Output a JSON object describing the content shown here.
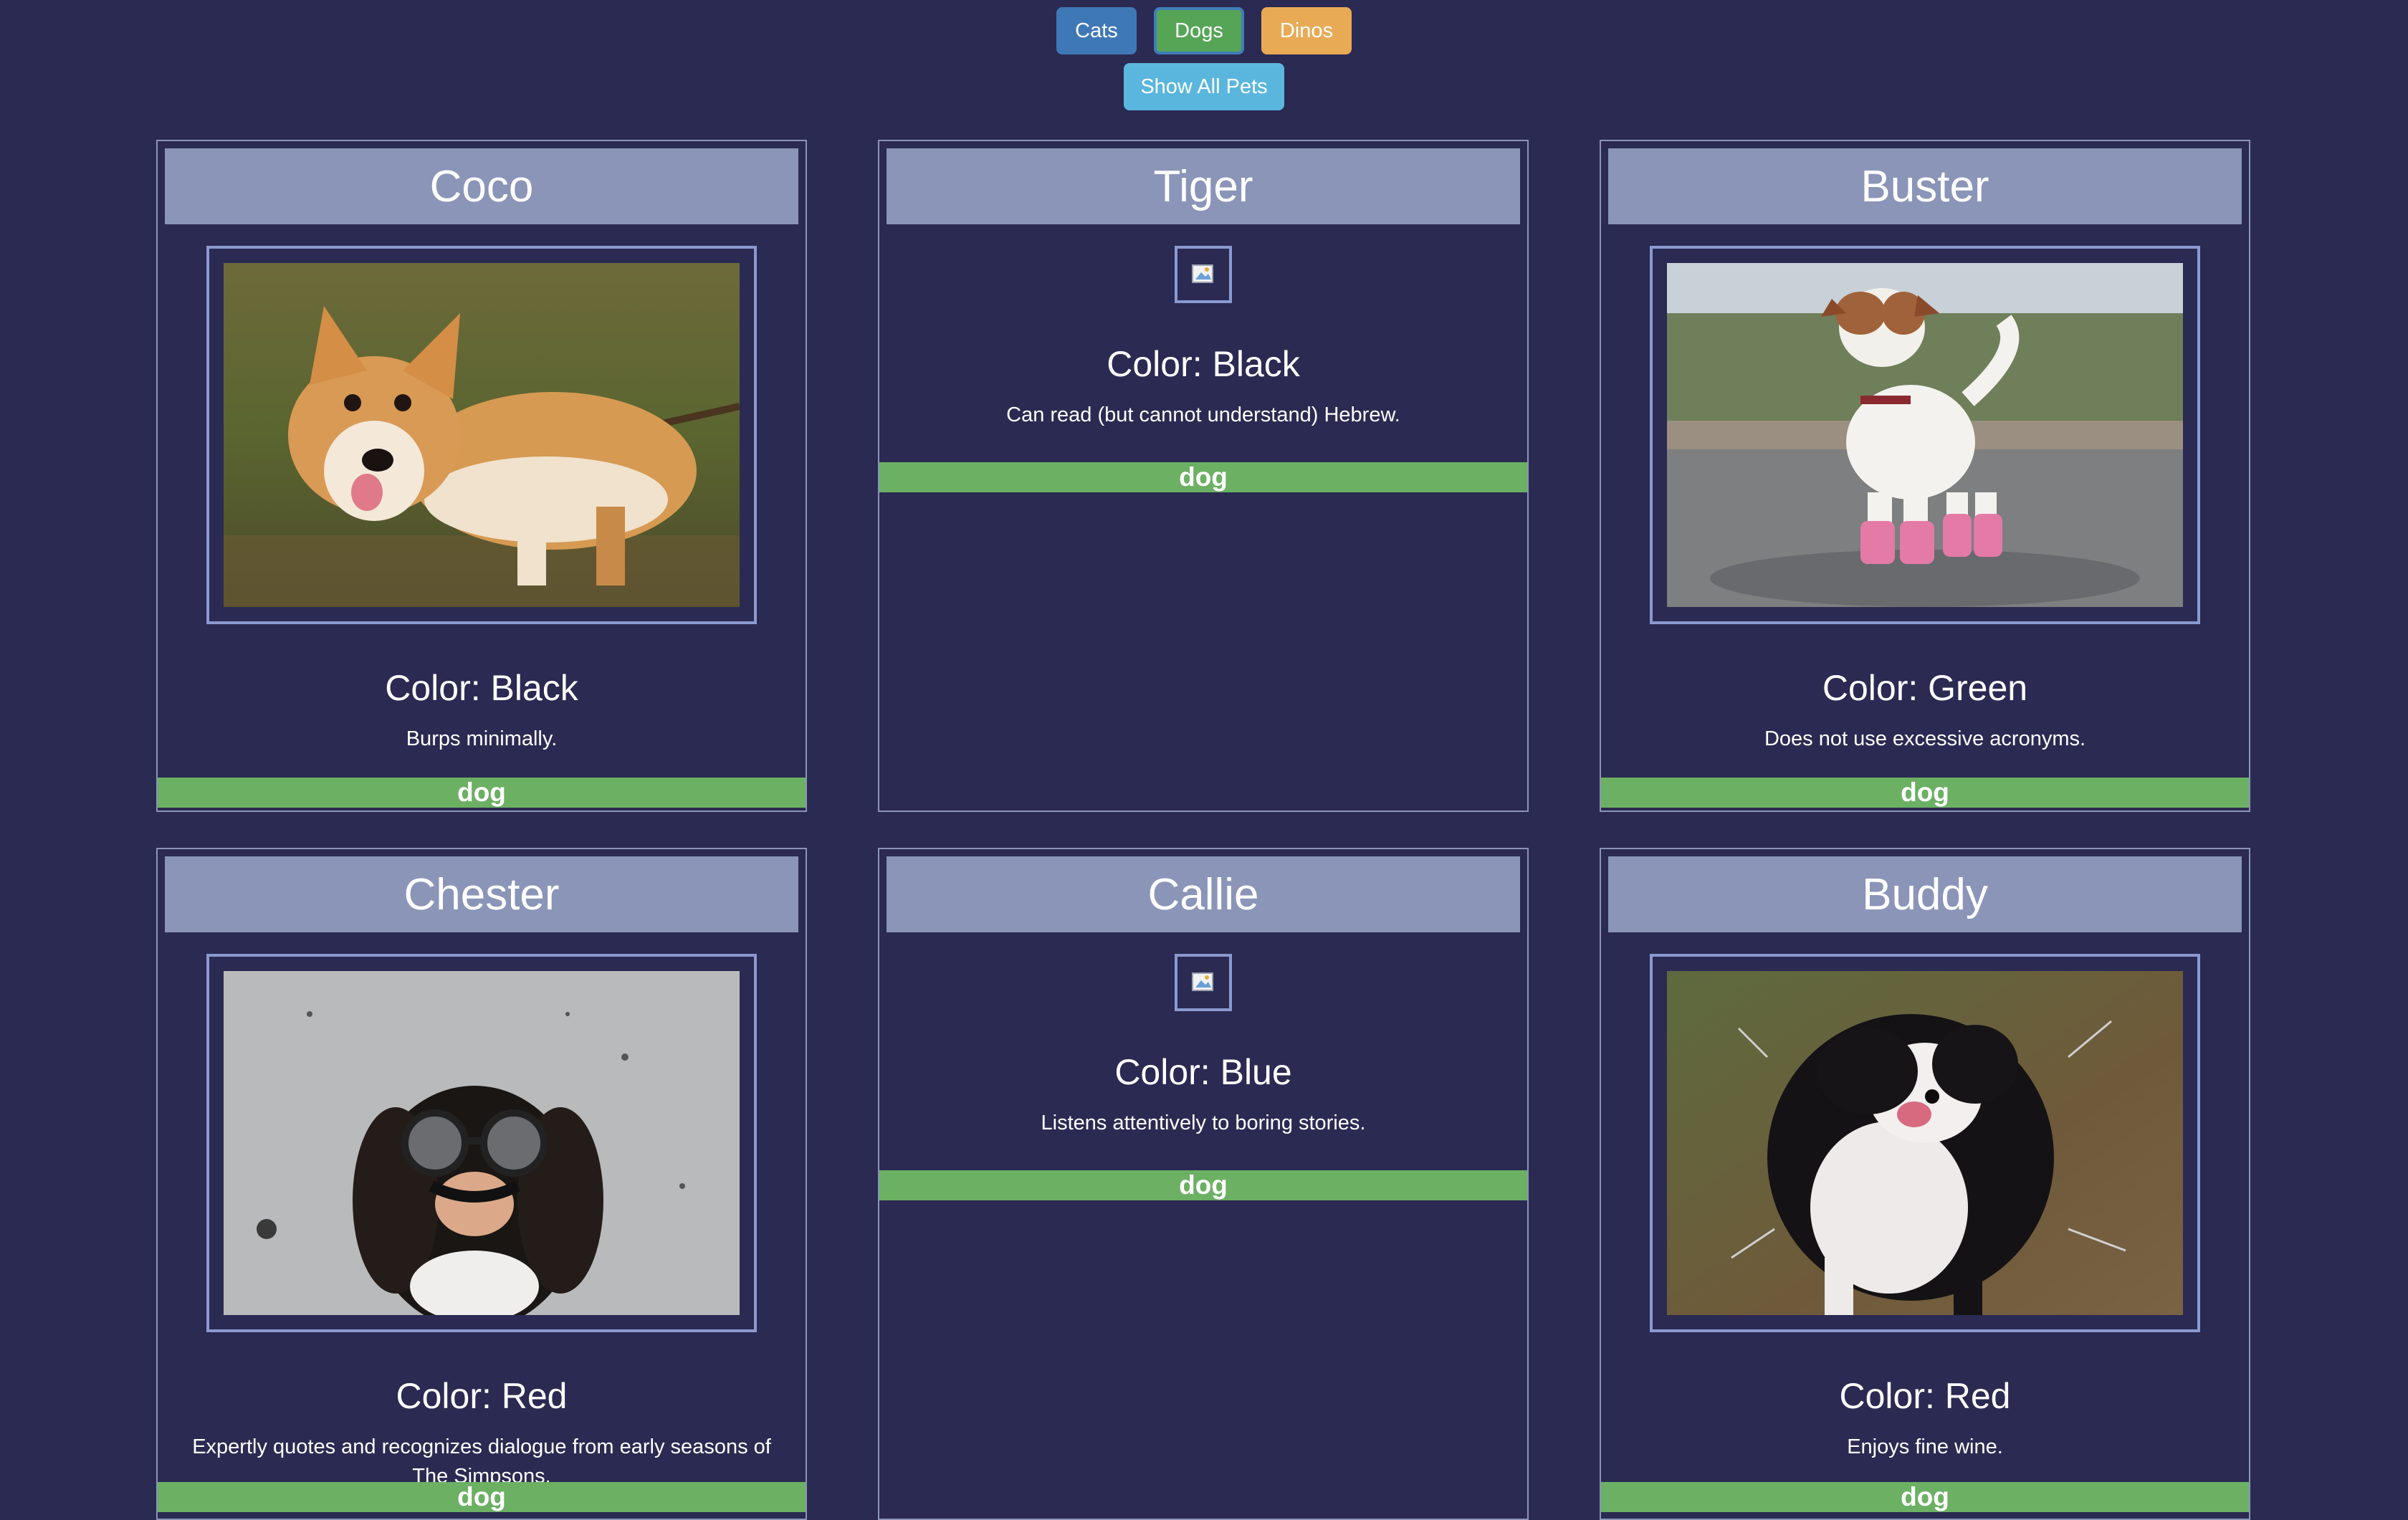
{
  "filters": {
    "cats": "Cats",
    "dogs": "Dogs",
    "dinos": "Dinos",
    "show_all": "Show All Pets"
  },
  "pets": [
    {
      "name": "Coco",
      "color": "Color: Black",
      "desc": "Burps minimally.",
      "type": "dog",
      "has_image": true,
      "image": "corgi-with-stick"
    },
    {
      "name": "Tiger",
      "color": "Color: Black",
      "desc": "Can read (but cannot understand) Hebrew.",
      "type": "dog",
      "has_image": false
    },
    {
      "name": "Buster",
      "color": "Color: Green",
      "desc": "Does not use excessive acronyms.",
      "type": "dog",
      "has_image": true,
      "image": "jack-russell-pink-boots"
    },
    {
      "name": "Chester",
      "color": "Color: Red",
      "desc": "Expertly quotes and recognizes dialogue from early seasons of The Simpsons.",
      "type": "dog",
      "has_image": true,
      "image": "spaniel-with-disguise-glasses"
    },
    {
      "name": "Callie",
      "color": "Color: Blue",
      "desc": "Listens attentively to boring stories.",
      "type": "dog",
      "has_image": false
    },
    {
      "name": "Buddy",
      "color": "Color: Red",
      "desc": "Enjoys fine wine.",
      "type": "dog",
      "has_image": true,
      "image": "border-collie-shaking"
    }
  ],
  "colors": {
    "background": "#2b2a52",
    "title_bar": "#8a95b8",
    "type_bar": "#6cb064",
    "cats_button": "#3f78b6",
    "dogs_button": "#56a557",
    "dinos_button": "#e8aa55",
    "show_all_button": "#5ab6dd"
  }
}
